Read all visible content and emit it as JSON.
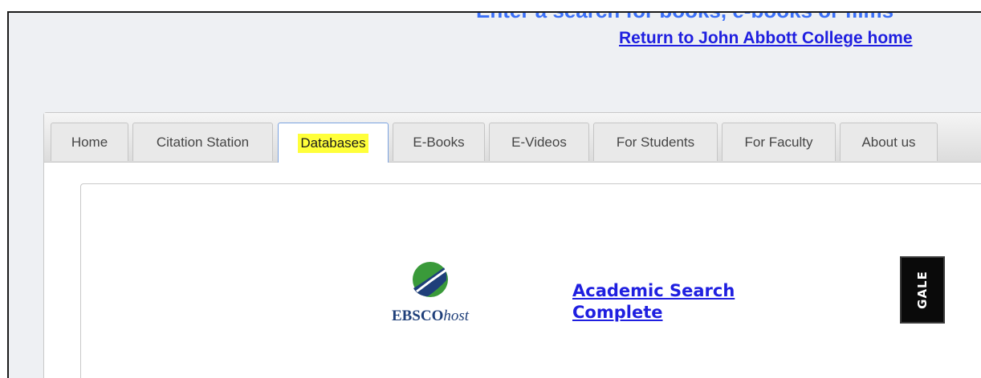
{
  "header": {
    "search_prompt": "Enter a search for books, e-books or films",
    "home_link": "Return to John Abbott College home"
  },
  "tabs": [
    {
      "label": "Home",
      "active": false
    },
    {
      "label": "Citation Station",
      "active": false
    },
    {
      "label": "Databases",
      "active": true,
      "highlight_color": "#ffff3a"
    },
    {
      "label": "E-Books",
      "active": false
    },
    {
      "label": "E-Videos",
      "active": false
    },
    {
      "label": "For Students",
      "active": false
    },
    {
      "label": "For Faculty",
      "active": false
    },
    {
      "label": "About us",
      "active": false
    }
  ],
  "databases": [
    {
      "provider_logo": {
        "bold": "EBSCO",
        "italic": "host",
        "icon": "ebsco-swoosh-icon"
      },
      "name": "Academic Search Complete"
    }
  ],
  "second_provider": {
    "logo_text": "GALE"
  },
  "colors": {
    "link": "#1f1fe0",
    "search_prompt": "#3a6ff7",
    "page_background": "#eef0f3",
    "ebsco_blue": "#1f3f7a",
    "ebsco_green": "#3a9a3a"
  }
}
